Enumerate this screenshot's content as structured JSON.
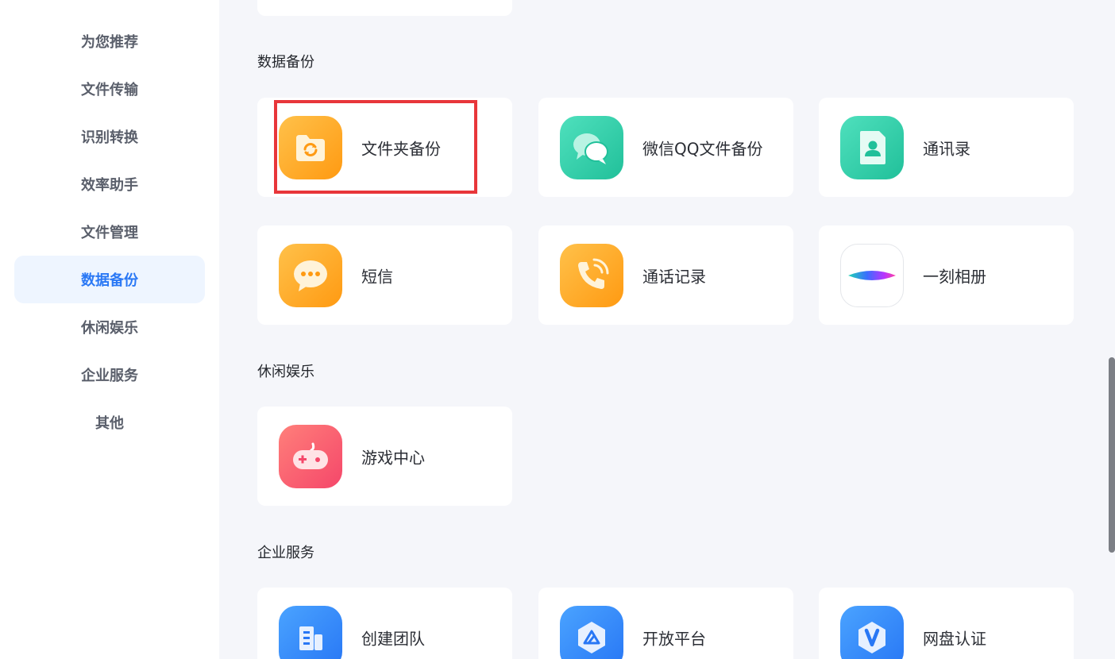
{
  "sidebar": {
    "items": [
      {
        "label": "为您推荐"
      },
      {
        "label": "文件传输"
      },
      {
        "label": "识别转换"
      },
      {
        "label": "效率助手"
      },
      {
        "label": "文件管理"
      },
      {
        "label": "数据备份",
        "active": true
      },
      {
        "label": "休闲娱乐"
      },
      {
        "label": "企业服务"
      },
      {
        "label": "其他"
      }
    ]
  },
  "sections": {
    "backup": {
      "title": "数据备份",
      "items": [
        {
          "label": "文件夹备份",
          "icon": "folder-sync-icon"
        },
        {
          "label": "微信QQ文件备份",
          "icon": "chat-bubbles-icon"
        },
        {
          "label": "通讯录",
          "icon": "contact-icon"
        },
        {
          "label": "短信",
          "icon": "message-icon"
        },
        {
          "label": "通话记录",
          "icon": "phone-icon"
        },
        {
          "label": "一刻相册",
          "icon": "album-icon"
        }
      ]
    },
    "leisure": {
      "title": "休闲娱乐",
      "items": [
        {
          "label": "游戏中心",
          "icon": "gamepad-icon"
        }
      ]
    },
    "enterprise": {
      "title": "企业服务",
      "items": [
        {
          "label": "创建团队",
          "icon": "team-icon"
        },
        {
          "label": "开放平台",
          "icon": "platform-icon"
        },
        {
          "label": "网盘认证",
          "icon": "verify-icon"
        }
      ]
    }
  },
  "colors": {
    "accent": "#2a78f5",
    "highlight": "#e8363a",
    "orange": "#ffa21d",
    "green": "#2dc7a0",
    "red": "#f5566a",
    "blue": "#2f86ff"
  }
}
